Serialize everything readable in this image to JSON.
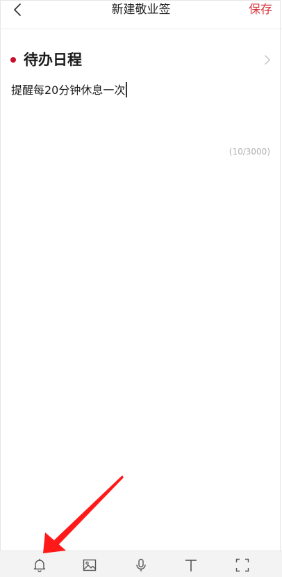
{
  "header": {
    "title": "新建敬业签",
    "save_label": "保存",
    "back_icon": "chevron-left-icon"
  },
  "category": {
    "label": "待办日程",
    "dot_color": "#c8102e",
    "chevron_icon": "chevron-right-icon"
  },
  "note": {
    "text": "提醒每20分钟休息一次",
    "char_count": "(10/3000)"
  },
  "toolbar": {
    "items": [
      {
        "name": "reminder",
        "icon": "bell-icon"
      },
      {
        "name": "image",
        "icon": "image-icon"
      },
      {
        "name": "voice",
        "icon": "microphone-icon"
      },
      {
        "name": "text-format",
        "icon": "text-icon"
      },
      {
        "name": "fullscreen",
        "icon": "fullscreen-icon"
      }
    ]
  },
  "colors": {
    "accent": "#d9363e",
    "annotation": "#ff1a1a",
    "toolbar_bg": "#f3f3f3"
  }
}
